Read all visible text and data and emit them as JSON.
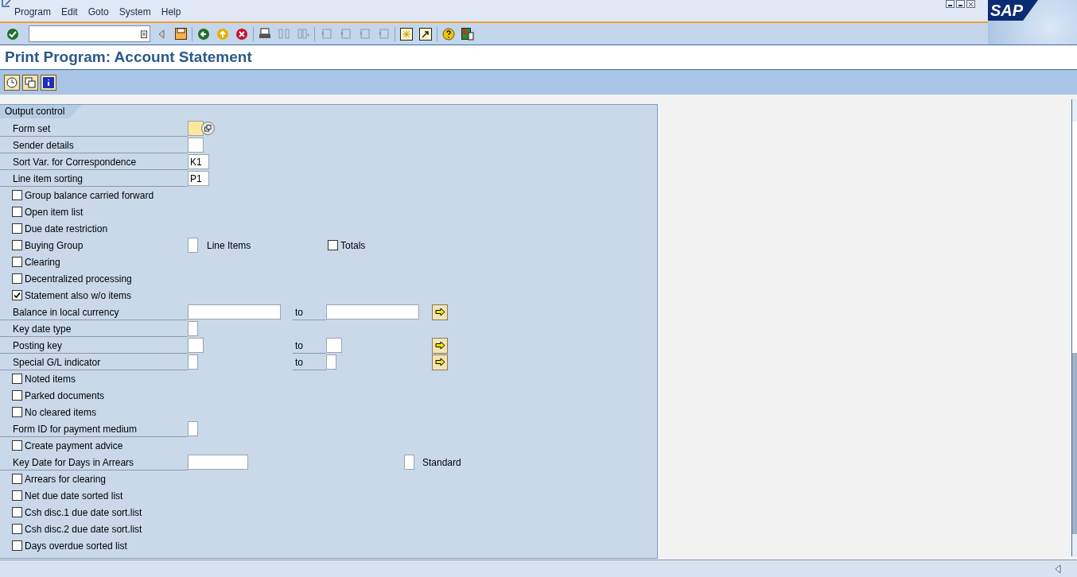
{
  "logo": "SAP",
  "menu": [
    "Program",
    "Edit",
    "Goto",
    "System",
    "Help"
  ],
  "title": "Print Program: Account Statement",
  "section": "Output control",
  "rows": [
    {
      "kind": "field",
      "label": "Form set",
      "value": "",
      "highlighted": true
    },
    {
      "kind": "field",
      "label": "Sender details",
      "value": "",
      "highlighted": false
    },
    {
      "kind": "field",
      "label": "Sort Var. for Correspondence",
      "value": "K1",
      "highlighted": false
    },
    {
      "kind": "field",
      "label": "Line item sorting",
      "value": "P1",
      "highlighted": false
    },
    {
      "kind": "checkbox",
      "label": "Group balance carried forward",
      "checked": false
    },
    {
      "kind": "checkbox",
      "label": "Open item list",
      "checked": false
    },
    {
      "kind": "checkbox",
      "label": "Due date restriction",
      "checked": false
    },
    {
      "kind": "checkbox",
      "label": "Buying Group",
      "checked": false,
      "field_label": "Line Items",
      "extra_checkbox": {
        "label": "Totals",
        "checked": false
      }
    },
    {
      "kind": "checkbox",
      "label": "Clearing",
      "checked": false
    },
    {
      "kind": "checkbox",
      "label": "Decentralized processing",
      "checked": false
    },
    {
      "kind": "checkbox",
      "label": "Statement also w/o items",
      "checked": true
    },
    {
      "kind": "range",
      "label": "Balance in local currency",
      "to_label": "to"
    },
    {
      "kind": "field",
      "label": "Key date type",
      "value": "",
      "highlighted": false
    },
    {
      "kind": "range",
      "label": "Posting key",
      "to_label": "to"
    },
    {
      "kind": "range",
      "label": "Special G/L indicator",
      "to_label": "to"
    },
    {
      "kind": "checkbox",
      "label": "Noted items",
      "checked": false
    },
    {
      "kind": "checkbox",
      "label": "Parked documents",
      "checked": false
    },
    {
      "kind": "checkbox",
      "label": "No cleared items",
      "checked": false
    },
    {
      "kind": "field",
      "label": "Form ID for payment medium",
      "value": "",
      "highlighted": false
    },
    {
      "kind": "checkbox",
      "label": "Create payment advice",
      "checked": false
    },
    {
      "kind": "field",
      "label": "Key Date for Days in Arrears",
      "value": "",
      "highlighted": false,
      "side_label": "Standard"
    },
    {
      "kind": "checkbox",
      "label": "Arrears for clearing",
      "checked": false
    },
    {
      "kind": "checkbox",
      "label": "Net due date sorted list",
      "checked": false
    },
    {
      "kind": "checkbox",
      "label": "Csh disc.1 due date sort.list",
      "checked": false
    },
    {
      "kind": "checkbox",
      "label": "Csh disc.2 due date sort.list",
      "checked": false
    },
    {
      "kind": "checkbox",
      "label": "Days overdue sorted list",
      "checked": false
    }
  ]
}
